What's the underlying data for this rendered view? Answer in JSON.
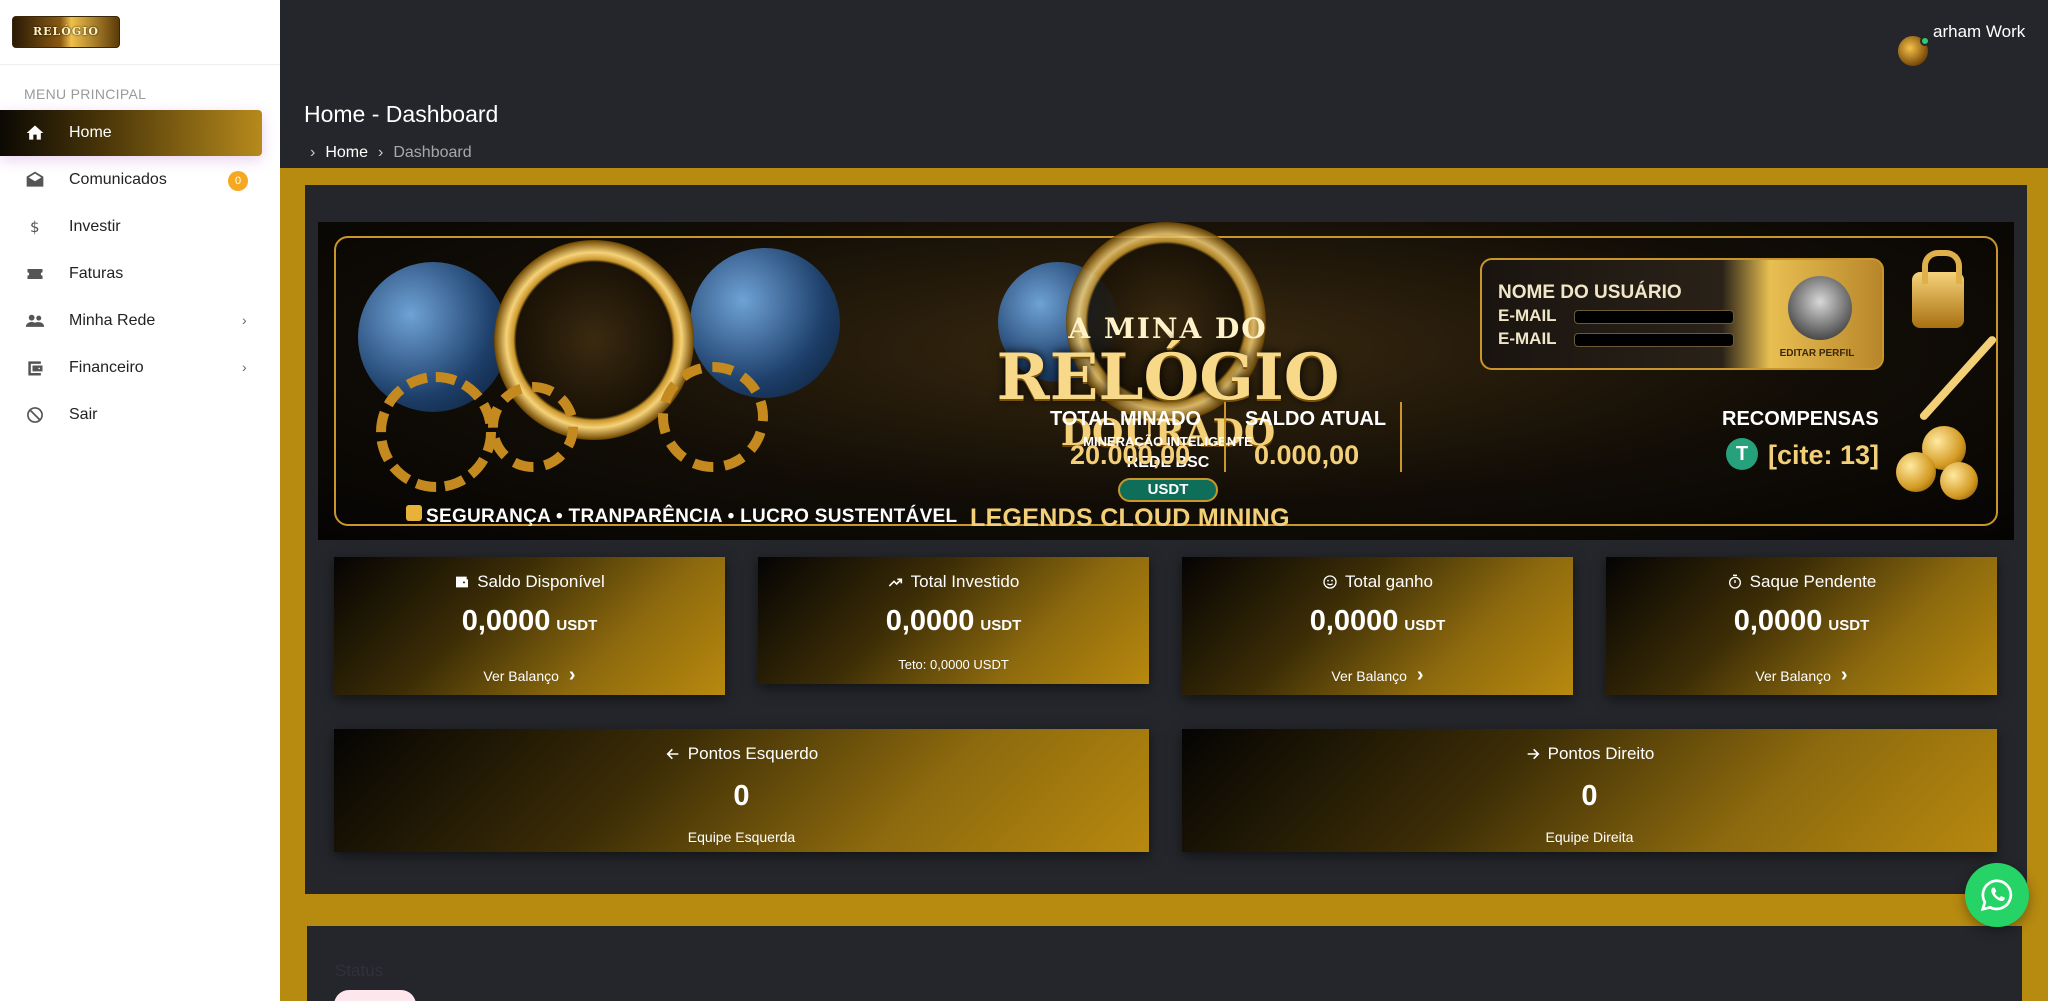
{
  "logo": {
    "text": "RELÓGIO"
  },
  "sidebar": {
    "section_title": "MENU PRINCIPAL",
    "items": [
      {
        "label": "Home",
        "icon": "home-icon"
      },
      {
        "label": "Comunicados",
        "icon": "envelope-icon",
        "badge": "0"
      },
      {
        "label": "Investir",
        "icon": "dollar-icon"
      },
      {
        "label": "Faturas",
        "icon": "ticket-icon"
      },
      {
        "label": "Minha Rede",
        "icon": "people-icon"
      },
      {
        "label": "Financeiro",
        "icon": "wallet-icon"
      },
      {
        "label": "Sair",
        "icon": "block-icon"
      }
    ]
  },
  "header": {
    "user_name": "arham Work",
    "page_title": "Home - Dashboard",
    "breadcrumb": {
      "home": "Home",
      "current": "Dashboard"
    }
  },
  "banner": {
    "top": "A MINA DO",
    "main": "RELÓGIO",
    "sub": "DOURADO",
    "tagline": "MINERAÇÃO INTELIGENTE",
    "network": "REDE BSC",
    "token": "USDT",
    "slogan": "SEGURANÇA • TRANPARÊNCIA • LUCRO SUSTENTÁVEL",
    "footer": "LEGENDS CLOUD MINING",
    "profile": {
      "name": "NOME DO USUÁRIO",
      "email1": "E-MAIL",
      "email2": "E-MAIL",
      "edit": "EDITAR PERFIL"
    },
    "stats": [
      {
        "label": "TOTAL MINADO",
        "value": "20.000,00"
      },
      {
        "label": "SALDO ATUAL",
        "value": "0.000,00"
      },
      {
        "label": "RECOMPENSAS",
        "value": "[cite: 13]"
      }
    ],
    "tether_symbol": "T"
  },
  "cards": [
    {
      "title": "Saldo Disponível",
      "value": "0,0000",
      "unit": "USDT",
      "link": "Ver Balanço"
    },
    {
      "title": "Total Investido",
      "value": "0,0000",
      "unit": "USDT",
      "note": "Teto: 0,0000 USDT"
    },
    {
      "title": "Total ganho",
      "value": "0,0000",
      "unit": "USDT",
      "link": "Ver Balanço"
    },
    {
      "title": "Saque Pendente",
      "value": "0,0000",
      "unit": "USDT",
      "link": "Ver Balanço"
    }
  ],
  "points": [
    {
      "title": "Pontos Esquerdo",
      "value": "0",
      "sub": "Equipe Esquerda"
    },
    {
      "title": "Pontos Direito",
      "value": "0",
      "sub": "Equipe Direita"
    }
  ],
  "status": {
    "label": "Status"
  },
  "colors": {
    "gold": "#b78a10",
    "dark": "#24262b",
    "whatsapp": "#25d366",
    "badge": "#f6a821"
  }
}
